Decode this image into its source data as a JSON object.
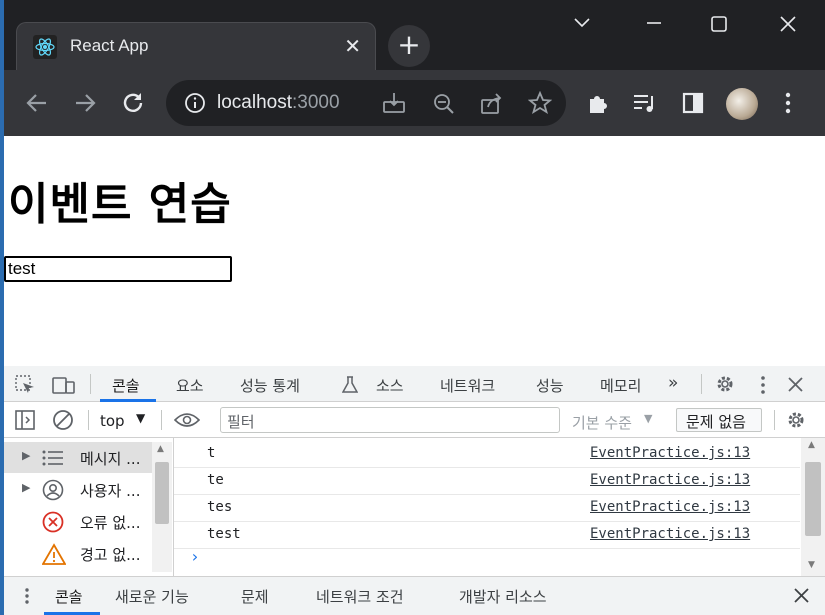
{
  "browser": {
    "tab_title": "React App",
    "new_tab_symbol": "+",
    "url_host": "localhost",
    "url_port": ":3000"
  },
  "page": {
    "heading": "이벤트 연습",
    "input_value": "test"
  },
  "devtools": {
    "tabs": [
      "콘솔",
      "요소",
      "성능 통계",
      "소스",
      "네트워크",
      "성능",
      "메모리"
    ],
    "context": "top",
    "filter_placeholder": "필터",
    "level": "기본 수준",
    "issues_button": "문제 없음",
    "sidebar": [
      "메시지 ...",
      "사용자 ...",
      "오류 없...",
      "경고 없..."
    ],
    "logs": [
      {
        "message": "t",
        "source": "EventPractice.js:13"
      },
      {
        "message": "te",
        "source": "EventPractice.js:13"
      },
      {
        "message": "tes",
        "source": "EventPractice.js:13"
      },
      {
        "message": "test",
        "source": "EventPractice.js:13"
      }
    ],
    "drawer_tabs": [
      "콘솔",
      "새로운 기능",
      "문제",
      "네트워크 조건",
      "개발자 리소스"
    ]
  },
  "colors": {
    "chrome_dark": "#202124",
    "chrome_toolbar": "#35363a",
    "accent": "#1a73e8",
    "error": "#d93025",
    "warning": "#e37400"
  }
}
